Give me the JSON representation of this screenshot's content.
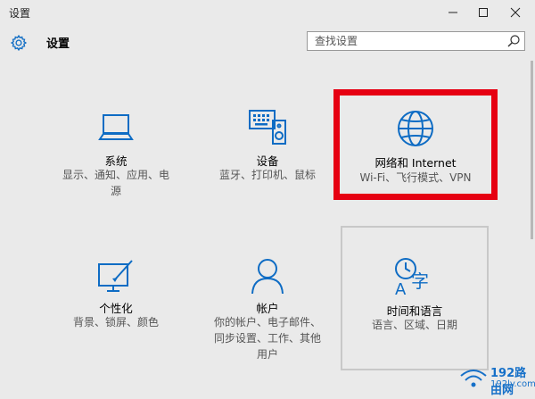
{
  "window": {
    "title": "设置",
    "minimize_icon": "minimize-icon",
    "maximize_icon": "maximize-icon",
    "close_icon": "close-icon"
  },
  "header": {
    "title": "设置",
    "icon": "gear-icon"
  },
  "search": {
    "placeholder": "查找设置",
    "value": "",
    "icon": "search-icon"
  },
  "tiles": [
    {
      "id": "system",
      "label": "系统",
      "desc_line1": "显示、通知、应用、电",
      "desc_line2": "源",
      "icon": "laptop-icon"
    },
    {
      "id": "devices",
      "label": "设备",
      "desc_line1": "蓝牙、打印机、鼠标",
      "icon": "keyboard-speaker-icon"
    },
    {
      "id": "network",
      "label": "网络和 Internet",
      "desc_line1": "Wi-Fi、飞行模式、VPN",
      "icon": "globe-icon",
      "highlighted": true
    },
    {
      "id": "personalization",
      "label": "个性化",
      "desc_line1": "背景、锁屏、颜色",
      "icon": "paint-screen-icon"
    },
    {
      "id": "accounts",
      "label": "帐户",
      "desc_line1": "你的帐户、电子邮件、",
      "desc_line2": "同步设置、工作、其他",
      "desc_line3": "用户",
      "icon": "person-icon"
    },
    {
      "id": "time_language",
      "label": "时间和语言",
      "desc_line1": "语言、区域、日期",
      "icon": "clock-language-icon",
      "hovered": true
    }
  ],
  "watermark": {
    "brand": "192路由网",
    "site": "192ly.com"
  },
  "colors": {
    "accent": "#0e6cc4",
    "highlight_border": "#e60012",
    "background": "#eaeaea"
  }
}
